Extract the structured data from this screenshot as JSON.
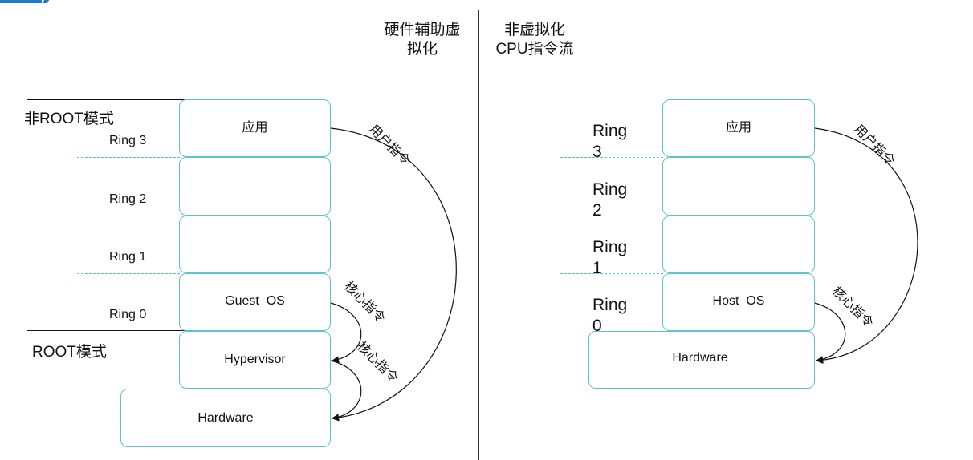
{
  "left": {
    "title_line1": "硬件辅助虚",
    "title_line2": "拟化",
    "non_root_mode": "非ROOT模式",
    "root_mode": "ROOT模式",
    "rings": [
      "Ring 3",
      "Ring 2",
      "Ring 1",
      "Ring 0"
    ],
    "layers": {
      "app": "应用",
      "guest_os": "Guest  OS",
      "hypervisor": "Hypervisor",
      "hardware": "Hardware"
    },
    "arrows": {
      "user_instruction": "用户指令",
      "kernel_instruction_1": "核心指令",
      "kernel_instruction_2": "核心指令"
    }
  },
  "right": {
    "title_line1": "非虚拟化",
    "title_line2": "CPU指令流",
    "rings": [
      {
        "word": "Ring",
        "num": "3"
      },
      {
        "word": "Ring",
        "num": "2"
      },
      {
        "word": "Ring",
        "num": "1"
      },
      {
        "word": "Ring",
        "num": "0"
      }
    ],
    "layers": {
      "app": "应用",
      "host_os": "Host  OS",
      "hardware": "Hardware"
    },
    "arrows": {
      "user_instruction": "用户指令",
      "kernel_instruction": "核心指令"
    }
  },
  "colors": {
    "box_border": "#5cc4cc",
    "line": "#111111",
    "accent_bar": "#1a7bd6"
  }
}
